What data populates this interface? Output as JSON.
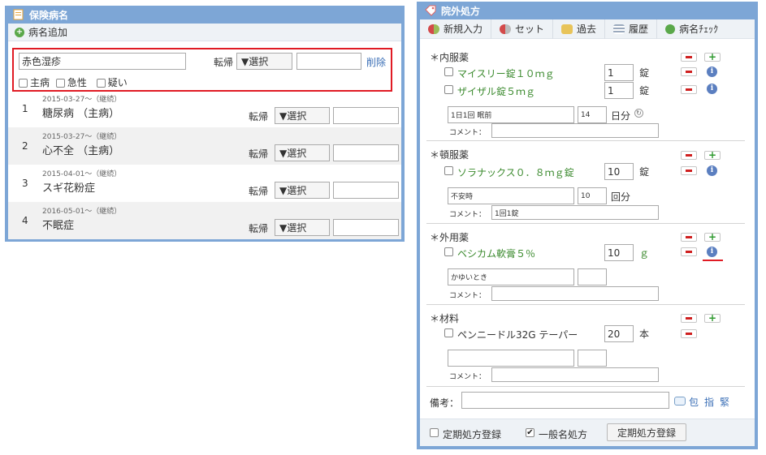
{
  "left_panel": {
    "title": "保険病名",
    "add_label": "病名追加",
    "new_entry": {
      "name_value": "赤色湿疹",
      "tenki_label": "転帰",
      "select_value": "▼選択",
      "date_value": "",
      "delete_label": "削除",
      "checkboxes": [
        "主病",
        "急性",
        "疑い"
      ]
    },
    "rows": [
      {
        "num": "1",
        "date": "2015-03-27～（継続）",
        "name": "糖尿病 （主病）",
        "tenki": "転帰",
        "select": "▼選択"
      },
      {
        "num": "2",
        "date": "2015-03-27～（継続）",
        "name": "心不全 （主病）",
        "tenki": "転帰",
        "select": "▼選択"
      },
      {
        "num": "3",
        "date": "2015-04-01～（継続）",
        "name": "スギ花粉症",
        "tenki": "転帰",
        "select": "▼選択"
      },
      {
        "num": "4",
        "date": "2016-05-01～（継続）",
        "name": "不眠症",
        "tenki": "転帰",
        "select": "▼選択"
      }
    ]
  },
  "right_panel": {
    "title": "院外処方",
    "toolbar": [
      "新規入力",
      "セット",
      "過去",
      "履歴",
      "病名ﾁｪｯｸ"
    ],
    "sections": {
      "naifuku": {
        "title": "＊内服薬",
        "drugs": [
          {
            "name": "マイスリー錠１０ｍｇ",
            "qty": "1",
            "unit": "錠"
          },
          {
            "name": "ザイザル錠５ｍｇ",
            "qty": "1",
            "unit": "錠"
          }
        ],
        "usage": "1日1回 眠前",
        "days": "14",
        "days_unit": "日分",
        "comment_label": "コメント：",
        "comment_value": ""
      },
      "tonpuku": {
        "title": "＊頓服薬",
        "drugs": [
          {
            "name": "ソラナックス０．８ｍｇ錠",
            "qty": "10",
            "unit": "錠"
          }
        ],
        "usage": "不安時",
        "times": "10",
        "times_unit": "回分",
        "comment_label": "コメント：",
        "comment_value": "1回1錠"
      },
      "gaiyou": {
        "title": "＊外用薬",
        "drugs": [
          {
            "name": "ベシカム軟膏５％",
            "qty": "10",
            "unit": "ｇ"
          }
        ],
        "usage": "かゆいとき",
        "times": "",
        "comment_label": "コメント：",
        "comment_value": ""
      },
      "zairyo": {
        "title": "＊材料",
        "drugs": [
          {
            "name": "ペンニードル32G テーパー",
            "qty": "20",
            "unit": "本"
          }
        ],
        "usage": "",
        "times": "",
        "comment_label": "コメント：",
        "comment_value": ""
      }
    },
    "biko_label": "備考：",
    "biko_value": "",
    "biko_links": [
      "包",
      "指",
      "緊"
    ],
    "footer": {
      "teiki_label": "定期処方登録",
      "ippan_label": "一般名処方",
      "register_button": "定期処方登録"
    }
  },
  "colors": {
    "panel_border": "#7da6d6",
    "highlight": "#e01b24",
    "drug_green": "#3b8a2e"
  }
}
